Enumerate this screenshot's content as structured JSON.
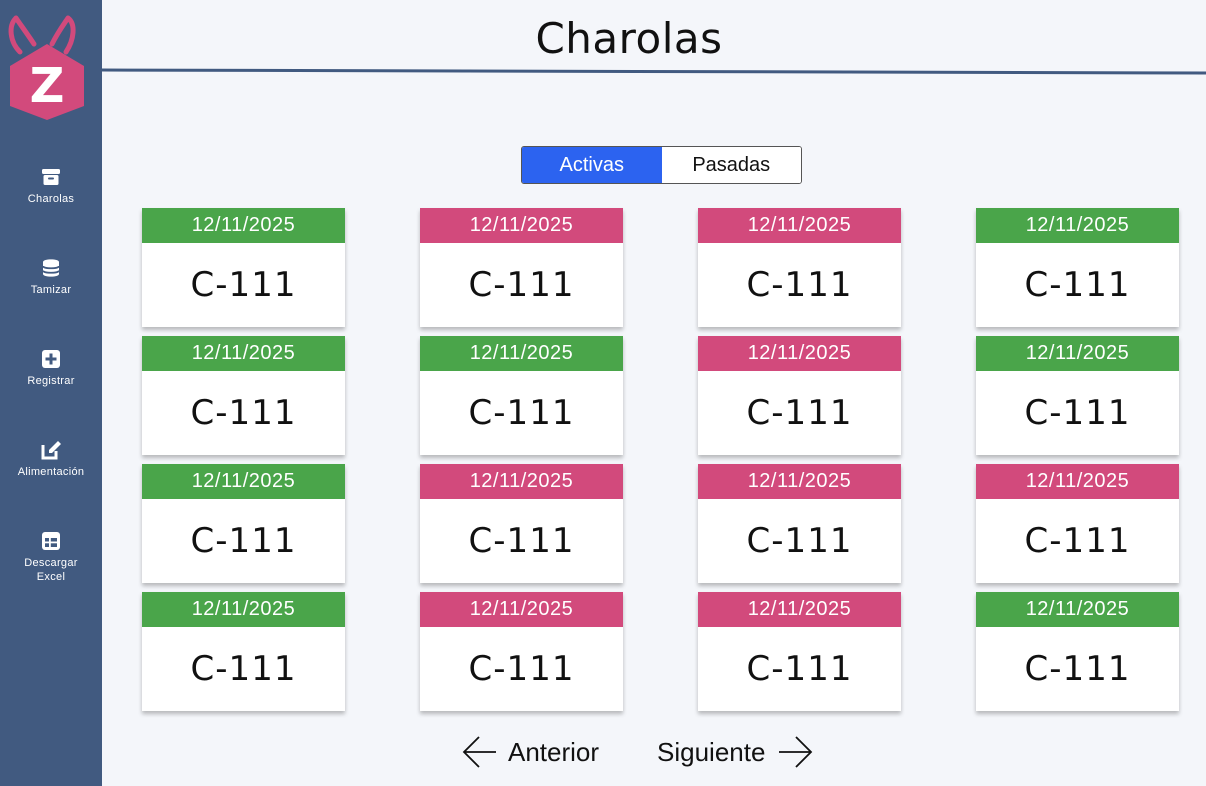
{
  "sidebar": {
    "logo_letter": "Z",
    "items": [
      {
        "label": "Charolas",
        "icon": "archive-icon"
      },
      {
        "label": "Tamizar",
        "icon": "database-icon"
      },
      {
        "label": "Registrar",
        "icon": "plus-square-icon"
      },
      {
        "label": "Alimentación",
        "icon": "edit-icon"
      },
      {
        "label": "Descargar Excel",
        "icon": "table-icon"
      }
    ]
  },
  "header": {
    "title": "Charolas"
  },
  "tabs": {
    "active": "Activas",
    "inactive": "Pasadas"
  },
  "colors": {
    "green": "#4aa54a",
    "pink": "#d24a7c",
    "accent": "#2c63f0",
    "sidebar": "#415a80"
  },
  "cards": [
    {
      "date": "12/11/2025",
      "code": "C-111",
      "status": "green"
    },
    {
      "date": "12/11/2025",
      "code": "C-111",
      "status": "pink"
    },
    {
      "date": "12/11/2025",
      "code": "C-111",
      "status": "pink"
    },
    {
      "date": "12/11/2025",
      "code": "C-111",
      "status": "green"
    },
    {
      "date": "12/11/2025",
      "code": "C-111",
      "status": "green"
    },
    {
      "date": "12/11/2025",
      "code": "C-111",
      "status": "green"
    },
    {
      "date": "12/11/2025",
      "code": "C-111",
      "status": "pink"
    },
    {
      "date": "12/11/2025",
      "code": "C-111",
      "status": "green"
    },
    {
      "date": "12/11/2025",
      "code": "C-111",
      "status": "green"
    },
    {
      "date": "12/11/2025",
      "code": "C-111",
      "status": "pink"
    },
    {
      "date": "12/11/2025",
      "code": "C-111",
      "status": "pink"
    },
    {
      "date": "12/11/2025",
      "code": "C-111",
      "status": "pink"
    },
    {
      "date": "12/11/2025",
      "code": "C-111",
      "status": "green"
    },
    {
      "date": "12/11/2025",
      "code": "C-111",
      "status": "pink"
    },
    {
      "date": "12/11/2025",
      "code": "C-111",
      "status": "pink"
    },
    {
      "date": "12/11/2025",
      "code": "C-111",
      "status": "green"
    }
  ],
  "pagination": {
    "prev": "Anterior",
    "next": "Siguiente"
  }
}
